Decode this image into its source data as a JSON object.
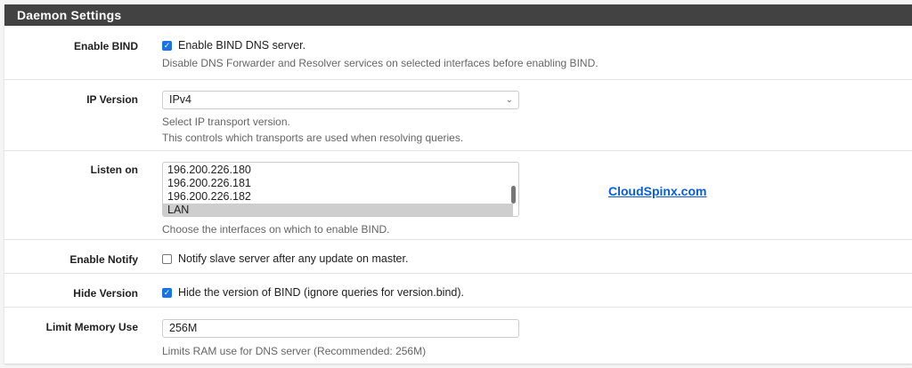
{
  "panel_title": "Daemon Settings",
  "enable_bind": {
    "label": "Enable BIND",
    "checked": true,
    "checkbox_text": "Enable BIND DNS server.",
    "hint": "Disable DNS Forwarder and Resolver services on selected interfaces before enabling BIND."
  },
  "ip_version": {
    "label": "IP Version",
    "value": "IPv4",
    "hint1": "Select IP transport version.",
    "hint2": "This controls which transports are used when resolving queries."
  },
  "listen_on": {
    "label": "Listen on",
    "options": [
      "196.200.226.180",
      "196.200.226.181",
      "196.200.226.182",
      "LAN"
    ],
    "selected": "LAN",
    "hint": "Choose the interfaces on which to enable BIND."
  },
  "watermark_link": "CloudSpinx.com",
  "enable_notify": {
    "label": "Enable Notify",
    "checked": false,
    "checkbox_text": "Notify slave server after any update on master."
  },
  "hide_version": {
    "label": "Hide Version",
    "checked": true,
    "checkbox_text": "Hide the version of BIND (ignore queries for version.bind)."
  },
  "limit_memory": {
    "label": "Limit Memory Use",
    "value": "256M",
    "hint": "Limits RAM use for DNS server (Recommended: 256M)"
  }
}
